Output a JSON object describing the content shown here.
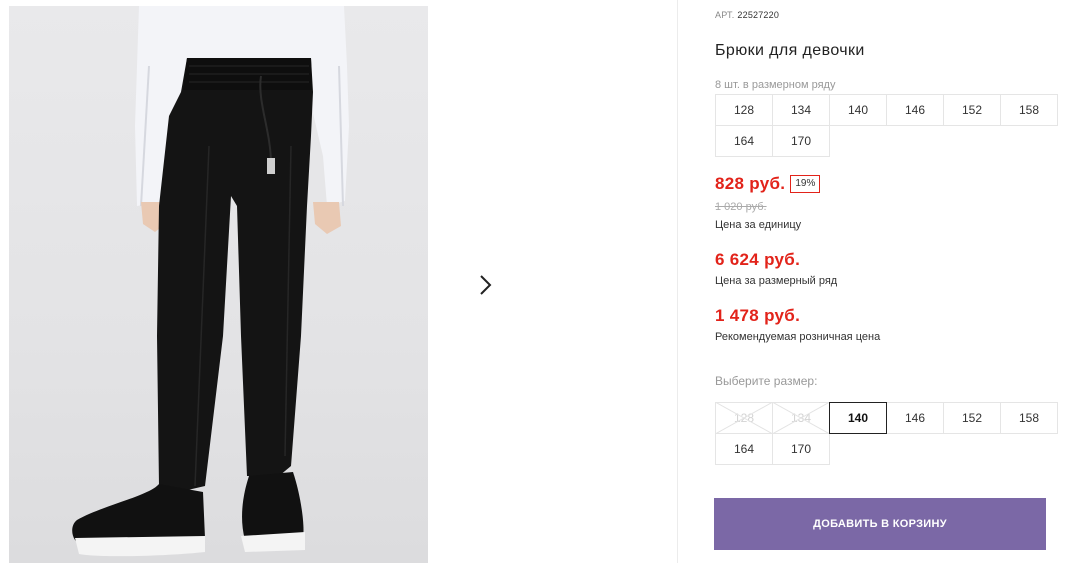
{
  "gallery": {
    "next_icon": "chevron-right-icon",
    "photo_icon": "product-photo"
  },
  "product": {
    "article_label": "АРТ.",
    "article_value": "22527220",
    "title": "Брюки для девочки",
    "row_count_text": "8 шт. в размерном ряду",
    "row_sizes": [
      "128",
      "134",
      "140",
      "146",
      "152",
      "158",
      "164",
      "170"
    ]
  },
  "pricing": {
    "unit_price": "828 руб.",
    "discount": "19%",
    "old_price": "1 020 руб.",
    "unit_caption": "Цена за единицу",
    "row_price": "6 624 руб.",
    "row_caption": "Цена за размерный ряд",
    "rrp_price": "1 478 руб.",
    "rrp_caption": "Рекомендуемая розничная цена",
    "accent_color": "#e2231a"
  },
  "size_select": {
    "label": "Выберите размер:",
    "sizes": [
      {
        "label": "128",
        "state": "unavailable"
      },
      {
        "label": "134",
        "state": "unavailable"
      },
      {
        "label": "140",
        "state": "selected"
      },
      {
        "label": "146",
        "state": "available"
      },
      {
        "label": "152",
        "state": "available"
      },
      {
        "label": "158",
        "state": "available"
      },
      {
        "label": "164",
        "state": "available"
      },
      {
        "label": "170",
        "state": "available"
      }
    ]
  },
  "cart": {
    "button_label": "ДОБАВИТЬ В КОРЗИНУ",
    "button_color": "#7b68a6"
  }
}
